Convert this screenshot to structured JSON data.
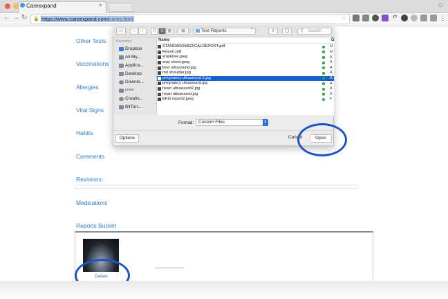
{
  "browser": {
    "tab_title": "Careexpand",
    "tab_close": "×",
    "url_host": "https://www.careexpand.com/",
    "url_path": "cares.html",
    "colors": {
      "close": "#ee5f57",
      "minimize": "#f5bd4f",
      "maximize": "#61c354"
    }
  },
  "sidebar": {
    "items": [
      "Other Tests",
      "Vaccinations",
      "Allergies",
      "Vital Signs",
      "Habits",
      "Comments",
      "Revisions",
      "Medications",
      "Reports Bucket"
    ]
  },
  "dialog": {
    "folder": "Test Reports",
    "search_placeholder": "Search",
    "favorites_header": "Favorites",
    "favorites": [
      "Dropbox",
      "All My...",
      "Applica...",
      "Desktop",
      "Downlo...",
      "javier",
      "Creativ...",
      "BitTorr..."
    ],
    "name_header": "Name",
    "files": [
      {
        "name": "STANDARDMEDICALREPORT.pdf",
        "kind": "M"
      },
      {
        "name": "Report.pdf",
        "kind": "M"
      },
      {
        "name": "xrayknee.jpeg",
        "kind": "A"
      },
      {
        "name": "xray chest.jpeg",
        "kind": "A"
      },
      {
        "name": "liver ultrasound.jpg",
        "kind": "A"
      },
      {
        "name": "mri shoulder.jpg",
        "kind": "A"
      },
      {
        "name": "pregnancy ultrasound 2.jpg",
        "kind": "A",
        "selected": true
      },
      {
        "name": "pregnancy ultrasound.jpg",
        "kind": "A"
      },
      {
        "name": "heart ultrasound2.jpg",
        "kind": "A"
      },
      {
        "name": "heart ultrasound.jpg",
        "kind": "A"
      },
      {
        "name": "EKG report2.jpeg",
        "kind": "F"
      }
    ],
    "format_label": "Format:",
    "format_value": "Custom Files",
    "options_label": "Options",
    "cancel_label": "Cancel",
    "open_label": "Open",
    "selection_color": "#1262d3"
  },
  "bucket": {
    "delete_label": "Delete"
  },
  "annotation_color": "#1c54c8"
}
